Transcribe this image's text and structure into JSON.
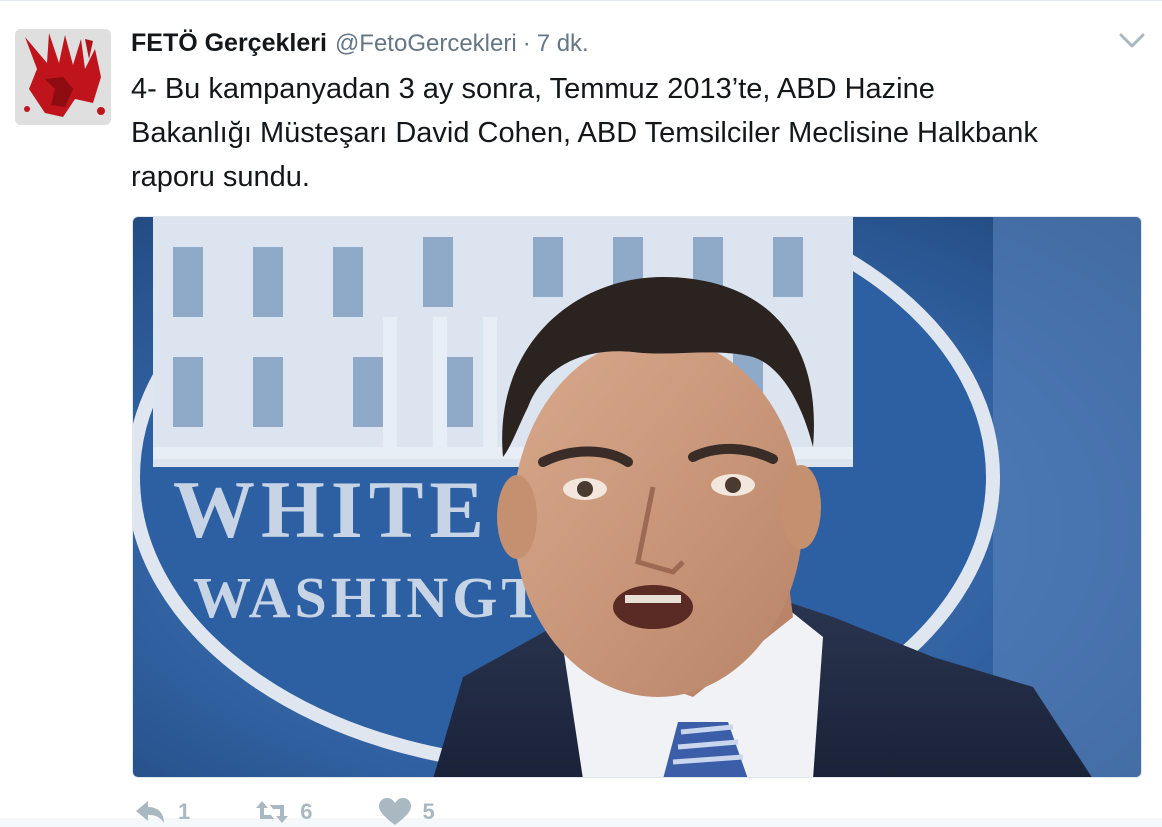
{
  "tweet": {
    "author": {
      "fullname": "FETÖ Gerçekleri",
      "username": "@FetoGercekleri",
      "separator": "·",
      "timestamp": "7 dk."
    },
    "text_lines": [
      "4- Bu kampanyadan 3 ay sonra, Temmuz 2013’te, ABD Hazine",
      "Bakanlığı Müsteşarı David Cohen, ABD Temsilciler Meclisine Halkbank",
      "raporu sundu."
    ],
    "media": {
      "sign_text_1": "WHITE",
      "sign_text_2": "WASHINGTO"
    },
    "actions": {
      "reply_count": "1",
      "retweet_count": "6",
      "like_count": "5"
    }
  },
  "colors": {
    "text": "#14171a",
    "secondary": "#657786",
    "action_gray": "#aab8c2",
    "avatar_red": "#c0141c",
    "backdrop_blue": "#2f5f9e"
  },
  "icons": {
    "caret": "chevron-down-icon",
    "reply": "reply-icon",
    "retweet": "retweet-icon",
    "like": "heart-icon"
  }
}
